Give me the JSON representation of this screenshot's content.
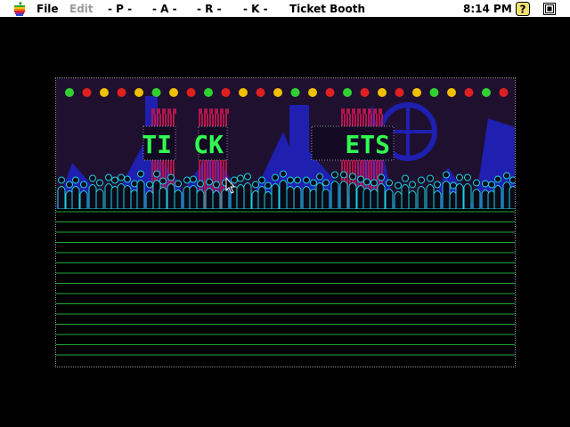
{
  "menubar": {
    "file": "File",
    "edit": "Edit",
    "p": "- P -",
    "a": "- A -",
    "r": "- R -",
    "k": "- K -",
    "title": "Ticket Booth",
    "clock": "8:14 PM"
  },
  "icons": {
    "apple": "apple-logo-icon",
    "help": "help-question-icon",
    "app": "application-icon",
    "cursor": "arrow-cursor-icon"
  },
  "scene": {
    "sign_parts": [
      "TI",
      "CK",
      "ETS"
    ]
  },
  "colors": {
    "sky": "#1f1030",
    "structures": "#1f1fb0",
    "neon_green": "#30ff50",
    "crowd_outline": "#1fd0e0",
    "tower_red": "#b0154a",
    "grass_line": "#1fa83a"
  }
}
